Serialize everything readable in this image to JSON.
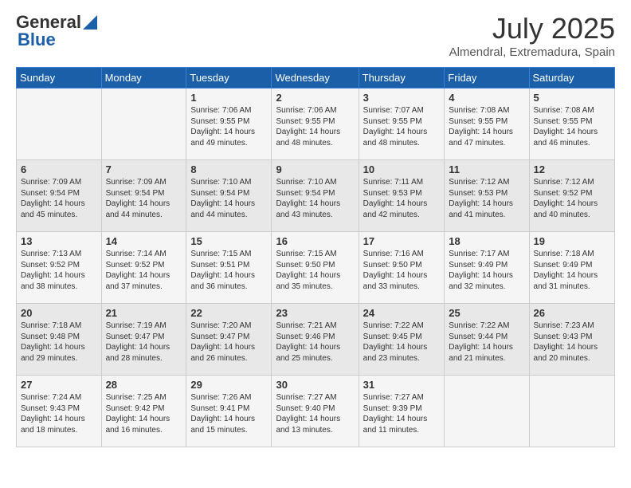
{
  "logo": {
    "general": "General",
    "blue": "Blue"
  },
  "title": "July 2025",
  "subtitle": "Almendral, Extremadura, Spain",
  "days_of_week": [
    "Sunday",
    "Monday",
    "Tuesday",
    "Wednesday",
    "Thursday",
    "Friday",
    "Saturday"
  ],
  "weeks": [
    [
      {
        "day": "",
        "info": ""
      },
      {
        "day": "",
        "info": ""
      },
      {
        "day": "1",
        "info": "Sunrise: 7:06 AM\nSunset: 9:55 PM\nDaylight: 14 hours and 49 minutes."
      },
      {
        "day": "2",
        "info": "Sunrise: 7:06 AM\nSunset: 9:55 PM\nDaylight: 14 hours and 48 minutes."
      },
      {
        "day": "3",
        "info": "Sunrise: 7:07 AM\nSunset: 9:55 PM\nDaylight: 14 hours and 48 minutes."
      },
      {
        "day": "4",
        "info": "Sunrise: 7:08 AM\nSunset: 9:55 PM\nDaylight: 14 hours and 47 minutes."
      },
      {
        "day": "5",
        "info": "Sunrise: 7:08 AM\nSunset: 9:55 PM\nDaylight: 14 hours and 46 minutes."
      }
    ],
    [
      {
        "day": "6",
        "info": "Sunrise: 7:09 AM\nSunset: 9:54 PM\nDaylight: 14 hours and 45 minutes."
      },
      {
        "day": "7",
        "info": "Sunrise: 7:09 AM\nSunset: 9:54 PM\nDaylight: 14 hours and 44 minutes."
      },
      {
        "day": "8",
        "info": "Sunrise: 7:10 AM\nSunset: 9:54 PM\nDaylight: 14 hours and 44 minutes."
      },
      {
        "day": "9",
        "info": "Sunrise: 7:10 AM\nSunset: 9:54 PM\nDaylight: 14 hours and 43 minutes."
      },
      {
        "day": "10",
        "info": "Sunrise: 7:11 AM\nSunset: 9:53 PM\nDaylight: 14 hours and 42 minutes."
      },
      {
        "day": "11",
        "info": "Sunrise: 7:12 AM\nSunset: 9:53 PM\nDaylight: 14 hours and 41 minutes."
      },
      {
        "day": "12",
        "info": "Sunrise: 7:12 AM\nSunset: 9:52 PM\nDaylight: 14 hours and 40 minutes."
      }
    ],
    [
      {
        "day": "13",
        "info": "Sunrise: 7:13 AM\nSunset: 9:52 PM\nDaylight: 14 hours and 38 minutes."
      },
      {
        "day": "14",
        "info": "Sunrise: 7:14 AM\nSunset: 9:52 PM\nDaylight: 14 hours and 37 minutes."
      },
      {
        "day": "15",
        "info": "Sunrise: 7:15 AM\nSunset: 9:51 PM\nDaylight: 14 hours and 36 minutes."
      },
      {
        "day": "16",
        "info": "Sunrise: 7:15 AM\nSunset: 9:50 PM\nDaylight: 14 hours and 35 minutes."
      },
      {
        "day": "17",
        "info": "Sunrise: 7:16 AM\nSunset: 9:50 PM\nDaylight: 14 hours and 33 minutes."
      },
      {
        "day": "18",
        "info": "Sunrise: 7:17 AM\nSunset: 9:49 PM\nDaylight: 14 hours and 32 minutes."
      },
      {
        "day": "19",
        "info": "Sunrise: 7:18 AM\nSunset: 9:49 PM\nDaylight: 14 hours and 31 minutes."
      }
    ],
    [
      {
        "day": "20",
        "info": "Sunrise: 7:18 AM\nSunset: 9:48 PM\nDaylight: 14 hours and 29 minutes."
      },
      {
        "day": "21",
        "info": "Sunrise: 7:19 AM\nSunset: 9:47 PM\nDaylight: 14 hours and 28 minutes."
      },
      {
        "day": "22",
        "info": "Sunrise: 7:20 AM\nSunset: 9:47 PM\nDaylight: 14 hours and 26 minutes."
      },
      {
        "day": "23",
        "info": "Sunrise: 7:21 AM\nSunset: 9:46 PM\nDaylight: 14 hours and 25 minutes."
      },
      {
        "day": "24",
        "info": "Sunrise: 7:22 AM\nSunset: 9:45 PM\nDaylight: 14 hours and 23 minutes."
      },
      {
        "day": "25",
        "info": "Sunrise: 7:22 AM\nSunset: 9:44 PM\nDaylight: 14 hours and 21 minutes."
      },
      {
        "day": "26",
        "info": "Sunrise: 7:23 AM\nSunset: 9:43 PM\nDaylight: 14 hours and 20 minutes."
      }
    ],
    [
      {
        "day": "27",
        "info": "Sunrise: 7:24 AM\nSunset: 9:43 PM\nDaylight: 14 hours and 18 minutes."
      },
      {
        "day": "28",
        "info": "Sunrise: 7:25 AM\nSunset: 9:42 PM\nDaylight: 14 hours and 16 minutes."
      },
      {
        "day": "29",
        "info": "Sunrise: 7:26 AM\nSunset: 9:41 PM\nDaylight: 14 hours and 15 minutes."
      },
      {
        "day": "30",
        "info": "Sunrise: 7:27 AM\nSunset: 9:40 PM\nDaylight: 14 hours and 13 minutes."
      },
      {
        "day": "31",
        "info": "Sunrise: 7:27 AM\nSunset: 9:39 PM\nDaylight: 14 hours and 11 minutes."
      },
      {
        "day": "",
        "info": ""
      },
      {
        "day": "",
        "info": ""
      }
    ]
  ]
}
